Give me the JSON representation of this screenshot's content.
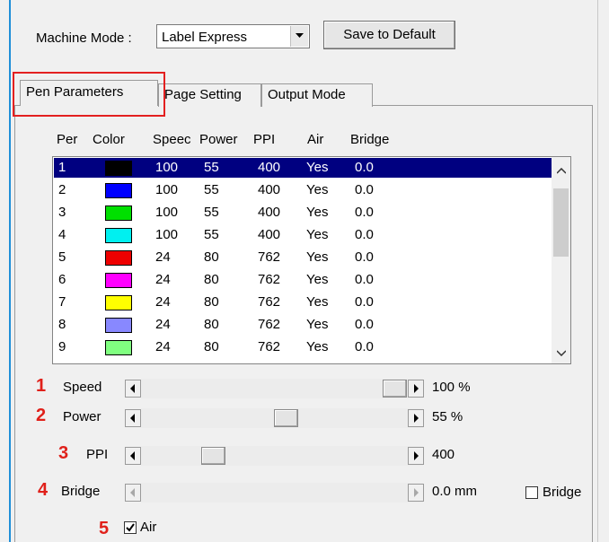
{
  "top": {
    "machine_mode_label": "Machine Mode :",
    "machine_mode_value": "Label Express",
    "save_button": "Save to Default"
  },
  "tabs": [
    {
      "label": "Pen Parameters",
      "active": true
    },
    {
      "label": "Page Setting",
      "active": false
    },
    {
      "label": "Output Mode",
      "active": false
    }
  ],
  "list": {
    "headers": [
      "Per",
      "Color",
      "Speec",
      "Power",
      "PPI",
      "Air",
      "Bridge"
    ],
    "rows": [
      {
        "per": "1",
        "color": "#000000",
        "speed": "100",
        "power": "55",
        "ppi": "400",
        "air": "Yes",
        "bridge": "0.0",
        "selected": true
      },
      {
        "per": "2",
        "color": "#0000ff",
        "speed": "100",
        "power": "55",
        "ppi": "400",
        "air": "Yes",
        "bridge": "0.0"
      },
      {
        "per": "3",
        "color": "#00e000",
        "speed": "100",
        "power": "55",
        "ppi": "400",
        "air": "Yes",
        "bridge": "0.0"
      },
      {
        "per": "4",
        "color": "#00f0f0",
        "speed": "100",
        "power": "55",
        "ppi": "400",
        "air": "Yes",
        "bridge": "0.0"
      },
      {
        "per": "5",
        "color": "#ee0000",
        "speed": "24",
        "power": "80",
        "ppi": "762",
        "air": "Yes",
        "bridge": "0.0"
      },
      {
        "per": "6",
        "color": "#ff00ff",
        "speed": "24",
        "power": "80",
        "ppi": "762",
        "air": "Yes",
        "bridge": "0.0"
      },
      {
        "per": "7",
        "color": "#ffff00",
        "speed": "24",
        "power": "80",
        "ppi": "762",
        "air": "Yes",
        "bridge": "0.0"
      },
      {
        "per": "8",
        "color": "#8888ff",
        "speed": "24",
        "power": "80",
        "ppi": "762",
        "air": "Yes",
        "bridge": "0.0"
      },
      {
        "per": "9",
        "color": "#80ff80",
        "speed": "24",
        "power": "80",
        "ppi": "762",
        "air": "Yes",
        "bridge": "0.0"
      }
    ]
  },
  "sliders": [
    {
      "marker": "1",
      "label": "Speed",
      "value_text": "100 %",
      "level": 1.0,
      "enabled": true
    },
    {
      "marker": "2",
      "label": "Power",
      "value_text": "55  %",
      "level": 0.55,
      "enabled": true
    },
    {
      "marker": "3",
      "label": "PPI",
      "value_text": "400",
      "level": 0.25,
      "enabled": true
    },
    {
      "marker": "4",
      "label": "Bridge",
      "value_text": "0.0 mm",
      "level": 0,
      "enabled": false
    }
  ],
  "bridge_checkbox": {
    "label": "Bridge",
    "checked": false
  },
  "air_checkbox": {
    "marker": "5",
    "label": "Air",
    "checked": true
  },
  "colors": {
    "selection": "#000080",
    "annotation": "#e0201a",
    "tab_highlight": "#e32020"
  }
}
